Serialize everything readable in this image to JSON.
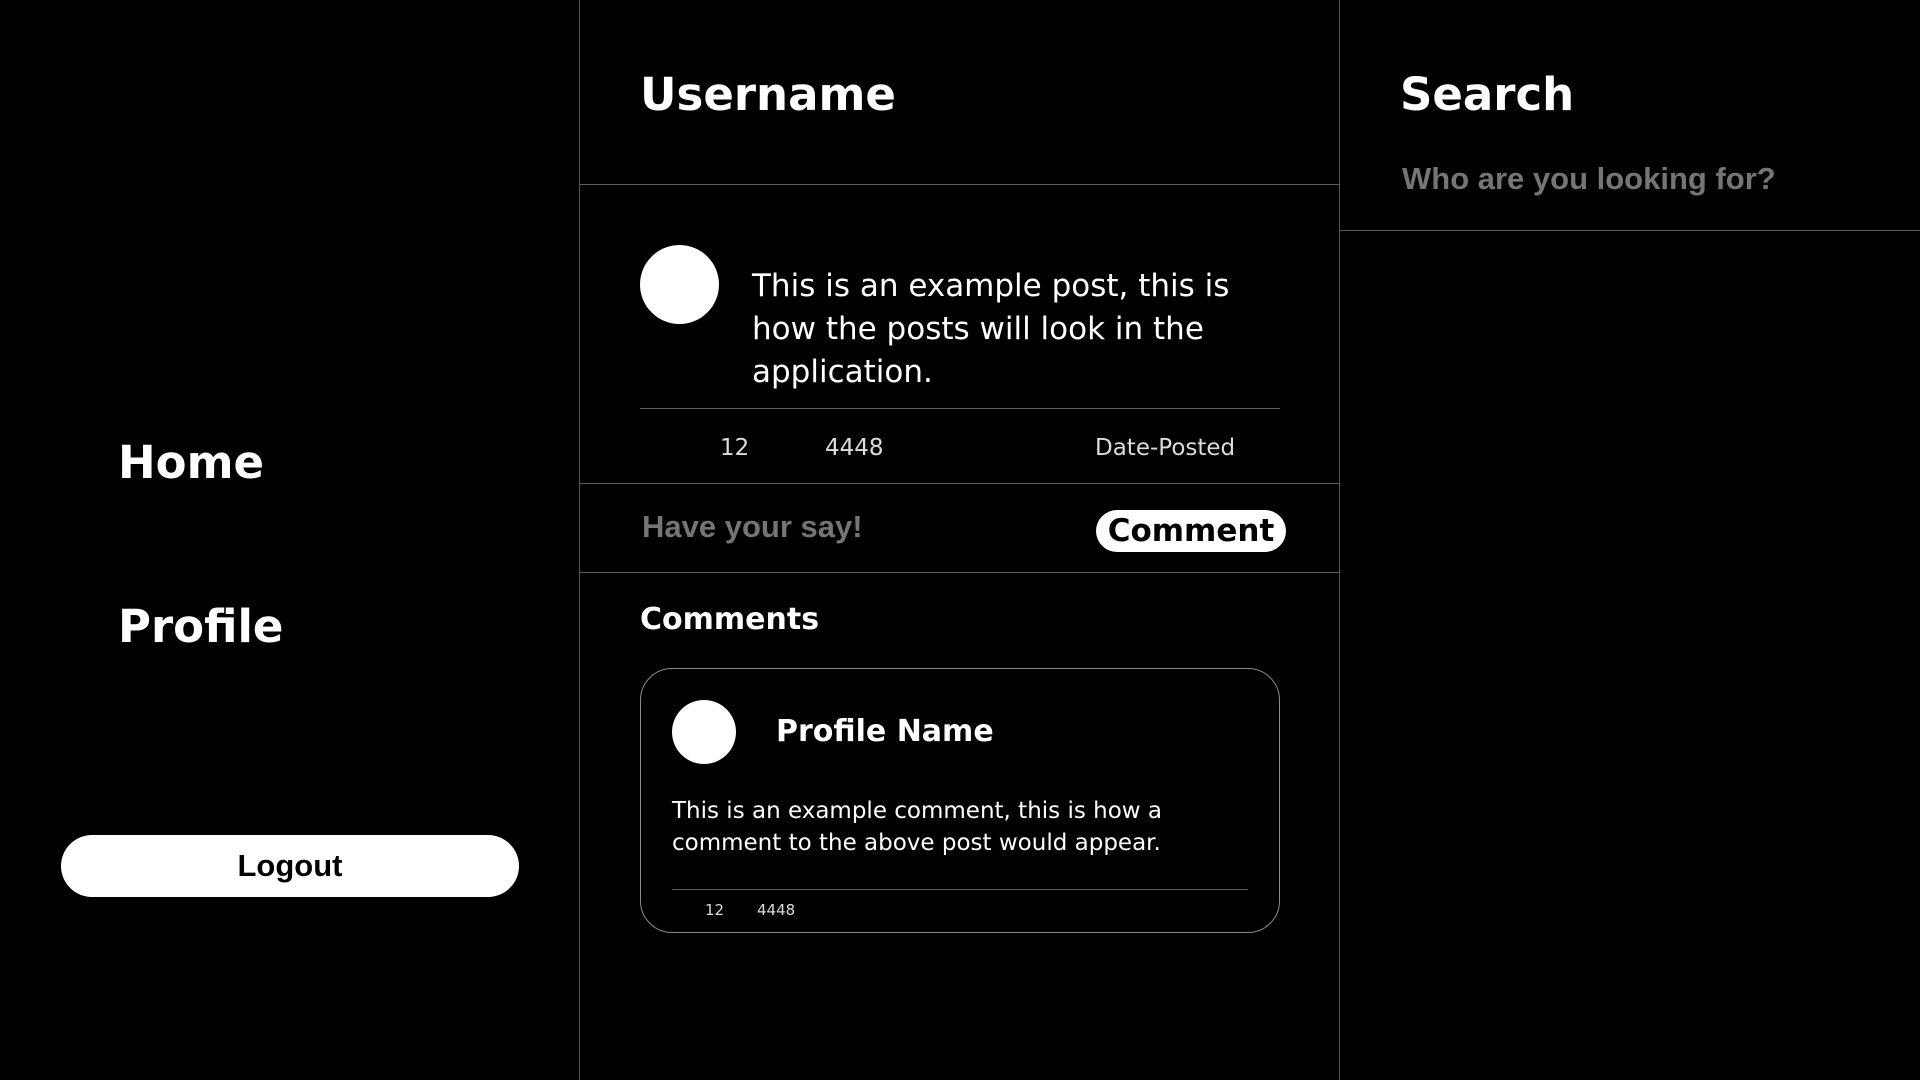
{
  "sidebar": {
    "items": [
      {
        "label": "Home"
      },
      {
        "label": "Profile"
      }
    ],
    "logout_label": "Logout"
  },
  "feed": {
    "header_title": "Username",
    "post": {
      "text": "This is an example post, this is how the posts will look in the application.",
      "stat_a": "12",
      "stat_b": "4448",
      "date": "Date-Posted"
    },
    "compose": {
      "placeholder": "Have your say!",
      "button_label": "Comment"
    },
    "comments_heading": "Comments",
    "comments": [
      {
        "profile_name": "Profile Name",
        "text": "This is an example comment, this is how a comment to the above post would appear.",
        "stat_a": "12",
        "stat_b": "4448"
      }
    ]
  },
  "search": {
    "title": "Search",
    "placeholder": "Who are you looking for?"
  },
  "colors": {
    "background": "#000000",
    "foreground": "#ffffff",
    "placeholder": "#6e6e6e",
    "divider": "#5a5a5a"
  }
}
